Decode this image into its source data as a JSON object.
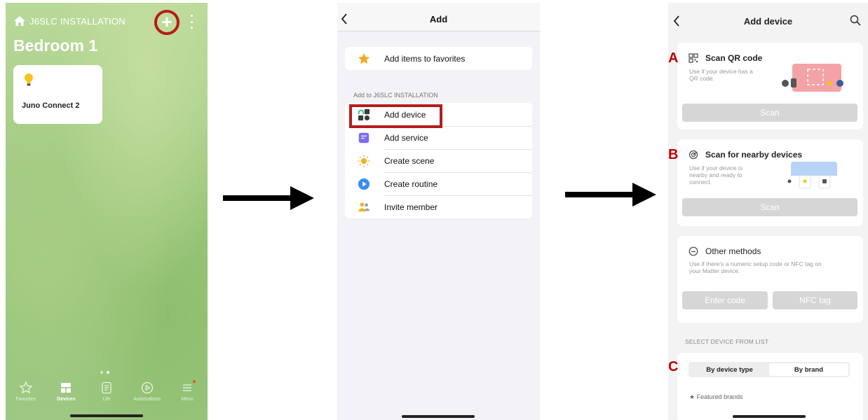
{
  "colors": {
    "highlight": "#b61c1c",
    "marker": "#c00000",
    "button_disabled": "#d6d6d6",
    "star": "#f6a71f",
    "service": "#7b6cf6",
    "scene": "#f6b21f",
    "routine": "#3b8ef0"
  },
  "screen1": {
    "home_name": "J6SLC INSTALLATION",
    "room_title": "Bedroom 1",
    "device": {
      "name": "Juno Connect 2",
      "icon": "bulb-icon"
    },
    "tabs": [
      {
        "label": "Favorites",
        "icon": "star-outline-icon"
      },
      {
        "label": "Devices",
        "icon": "grid-icon"
      },
      {
        "label": "Life",
        "icon": "list-icon"
      },
      {
        "label": "Automations",
        "icon": "play-circle-icon"
      },
      {
        "label": "Menu",
        "icon": "hamburger-icon"
      }
    ]
  },
  "screen2": {
    "title": "Add",
    "favorites_label": "Add items to favorites",
    "section_header": "Add to J6SLC INSTALLATION",
    "items": [
      {
        "label": "Add device",
        "icon": "add-device-icon"
      },
      {
        "label": "Add service",
        "icon": "service-icon"
      },
      {
        "label": "Create scene",
        "icon": "sun-icon"
      },
      {
        "label": "Create routine",
        "icon": "play-icon"
      },
      {
        "label": "Invite member",
        "icon": "people-icon"
      }
    ]
  },
  "screen3": {
    "title": "Add device",
    "qr": {
      "title": "Scan QR code",
      "desc_1": "Use if your device has a",
      "desc_2": "QR code.",
      "button": "Scan"
    },
    "nearby": {
      "title": "Scan for nearby devices",
      "desc_1": "Use if your device is",
      "desc_2": "nearby and ready to",
      "desc_3": "connect.",
      "button": "Scan"
    },
    "other": {
      "title": "Other methods",
      "desc_1": "Use if there's a numeric setup code or NFC tag on",
      "desc_2": "your Matter device.",
      "button_code": "Enter code",
      "button_nfc": "NFC tag"
    },
    "list_header": "SELECT DEVICE FROM LIST",
    "segments": [
      "By device type",
      "By brand"
    ],
    "featured": "★ Featured brands"
  },
  "markers": {
    "a": "A",
    "b": "B",
    "c": "C"
  }
}
